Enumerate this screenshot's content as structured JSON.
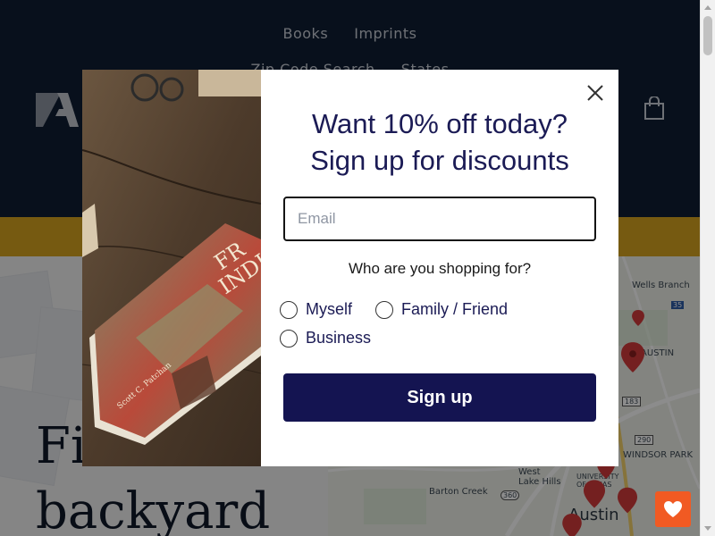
{
  "header": {
    "nav_row1": [
      "Books",
      "Imprints"
    ],
    "nav_row2": [
      "Zip Code Search",
      "States"
    ],
    "logo_icon": "logo-a-icon",
    "cart_icon": "shopping-bag-icon"
  },
  "hero": {
    "title_line1": "Fi",
    "title_line2": "backyard",
    "map_labels": {
      "wells_branch": "Wells Branch",
      "austin_small": "AUSTIN",
      "windsor_park": "WINDSOR PARK",
      "west_lake_hills": "West\nLake Hills",
      "barton_creek": "Barton Creek",
      "university": "UNIVERSITY\nOF TEXAS",
      "austin_big": "Austin",
      "hw_183": "183",
      "hw_290": "290",
      "hw_360": "360",
      "hw_35": "35"
    }
  },
  "modal": {
    "headline_line1": "Want 10% off today?",
    "headline_line2": "Sign up for discounts",
    "email_placeholder": "Email",
    "question": "Who are you shopping for?",
    "options": [
      "Myself",
      "Family / Friend",
      "Business"
    ],
    "submit_label": "Sign up",
    "close_icon": "close-icon",
    "book_cover_text": {
      "title_part1": "FR",
      "title_part2": "INDIA",
      "author": "Scott C. Patchan"
    }
  },
  "colors": {
    "header_bg": "#0f1e33",
    "yellow_bar": "#d8a51f",
    "headline": "#1b1b55",
    "button_bg": "#141451",
    "wishlist_bg": "#f15a23"
  },
  "wishlist_icon": "heart-icon"
}
